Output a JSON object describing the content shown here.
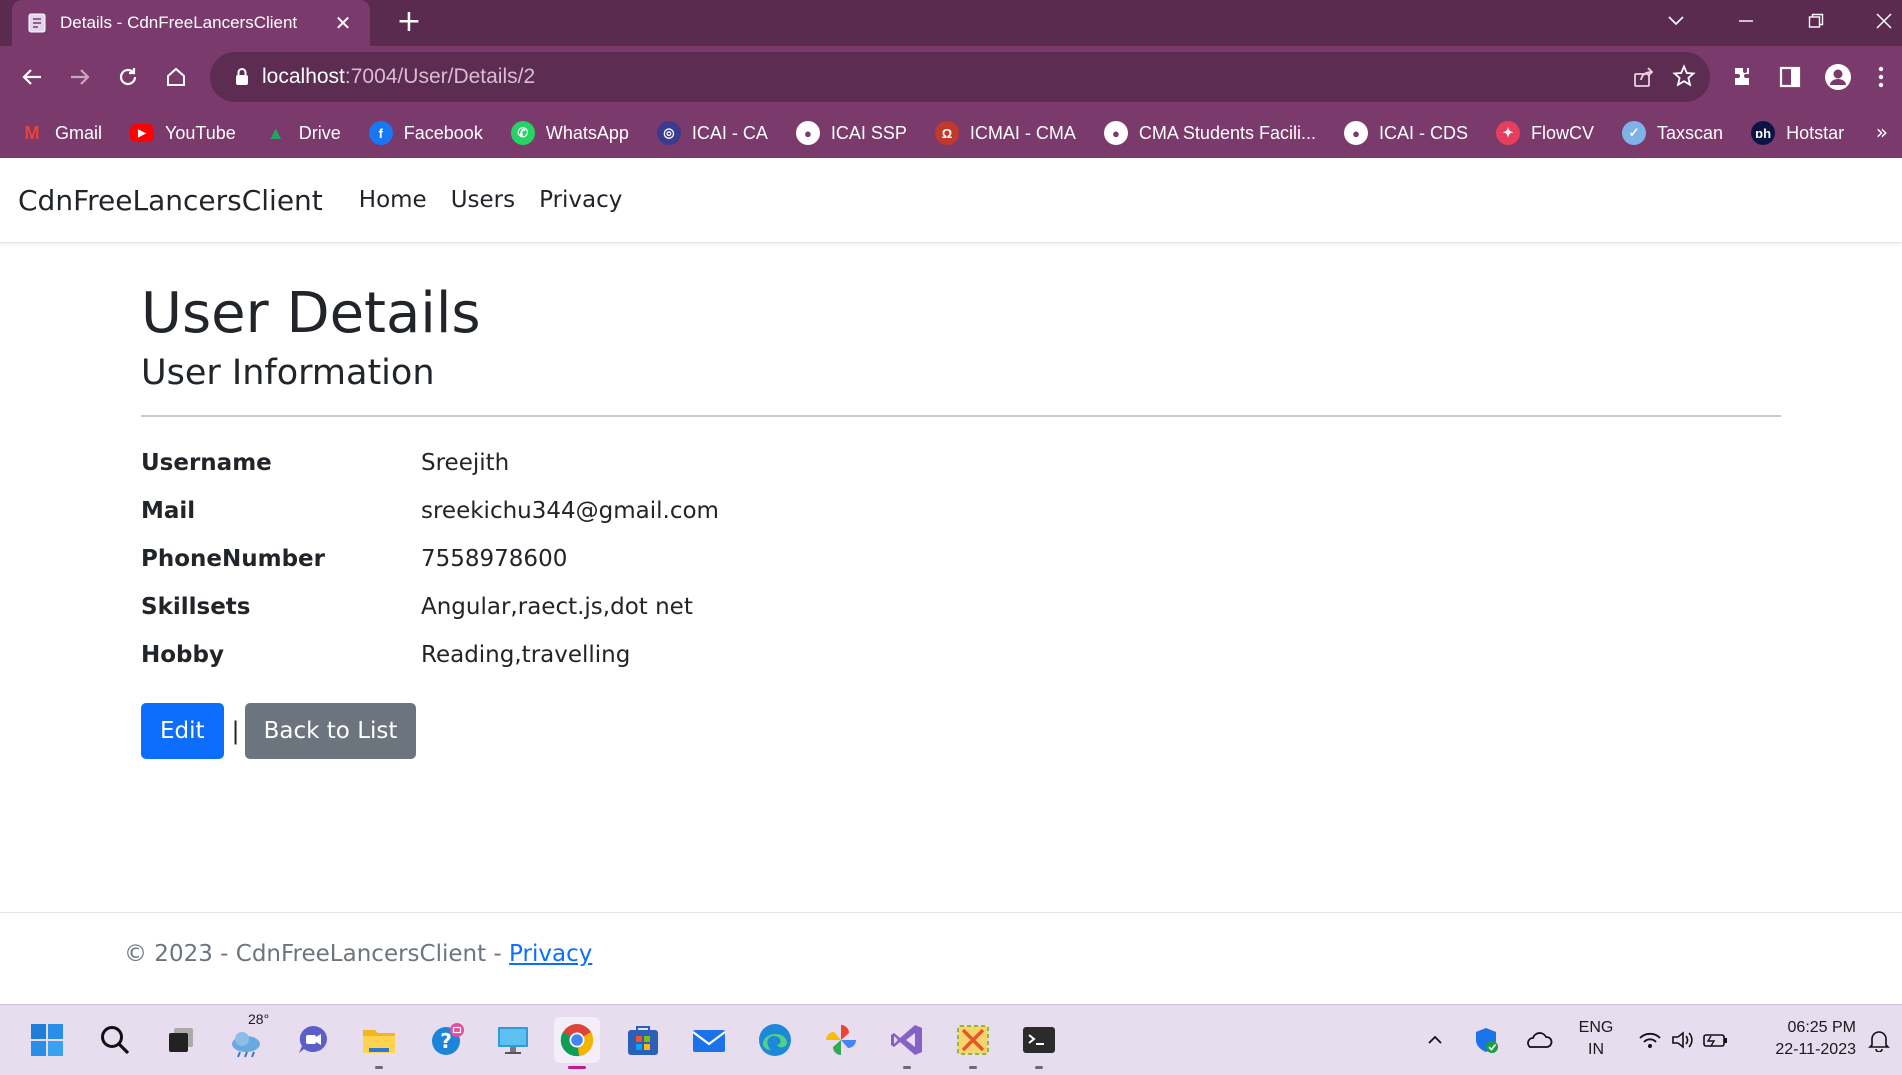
{
  "browser": {
    "tab_title": "Details - CdnFreeLancersClient",
    "tab_close": "✕",
    "new_tab": "+",
    "url_host": "localhost",
    "url_path": ":7004/User/Details/2",
    "bookmarks": [
      {
        "label": "Gmail",
        "icon": "gmail-icon",
        "color": "#ea4335"
      },
      {
        "label": "YouTube",
        "icon": "youtube-icon",
        "color": "#ff0000"
      },
      {
        "label": "Drive",
        "icon": "drive-icon",
        "color": "#1fa463"
      },
      {
        "label": "Facebook",
        "icon": "facebook-icon",
        "color": "#1877f2"
      },
      {
        "label": "WhatsApp",
        "icon": "whatsapp-icon",
        "color": "#25d366"
      },
      {
        "label": "ICAI - CA",
        "icon": "icai-icon",
        "color": "#3b3b8f"
      },
      {
        "label": "ICAI SSP",
        "icon": "globe-icon",
        "color": "#ffffff"
      },
      {
        "label": "ICMAI - CMA",
        "icon": "icmai-icon",
        "color": "#c0392b"
      },
      {
        "label": "CMA Students Facili...",
        "icon": "globe-icon",
        "color": "#ffffff"
      },
      {
        "label": "ICAI - CDS",
        "icon": "globe-icon",
        "color": "#ffffff"
      },
      {
        "label": "FlowCV",
        "icon": "flowcv-icon",
        "color": "#e53e5f"
      },
      {
        "label": "Taxscan",
        "icon": "taxscan-icon",
        "color": "#7fb3e8"
      },
      {
        "label": "Hotstar",
        "icon": "hotstar-icon",
        "color": "#0c1445"
      }
    ],
    "bookmarks_more": "»"
  },
  "navbar": {
    "brand": "CdnFreeLancersClient",
    "links": [
      "Home",
      "Users",
      "Privacy"
    ]
  },
  "page": {
    "title": "User Details",
    "subtitle": "User Information",
    "fields": [
      {
        "label": "Username",
        "value": "Sreejith"
      },
      {
        "label": "Mail",
        "value": "sreekichu344@gmail.com"
      },
      {
        "label": "PhoneNumber",
        "value": "7558978600"
      },
      {
        "label": "Skillsets",
        "value": "Angular,raect.js,dot net"
      },
      {
        "label": "Hobby",
        "value": "Reading,travelling"
      }
    ],
    "edit_label": "Edit",
    "separator": "|",
    "back_label": "Back to List"
  },
  "footer": {
    "copyright": "© 2023 - CdnFreeLancersClient - ",
    "privacy_link": "Privacy"
  },
  "taskbar": {
    "weather": "28°",
    "lang_top": "ENG",
    "lang_bottom": "IN",
    "time": "06:25 PM",
    "date": "22-11-2023",
    "accent": "#c21b8a"
  }
}
